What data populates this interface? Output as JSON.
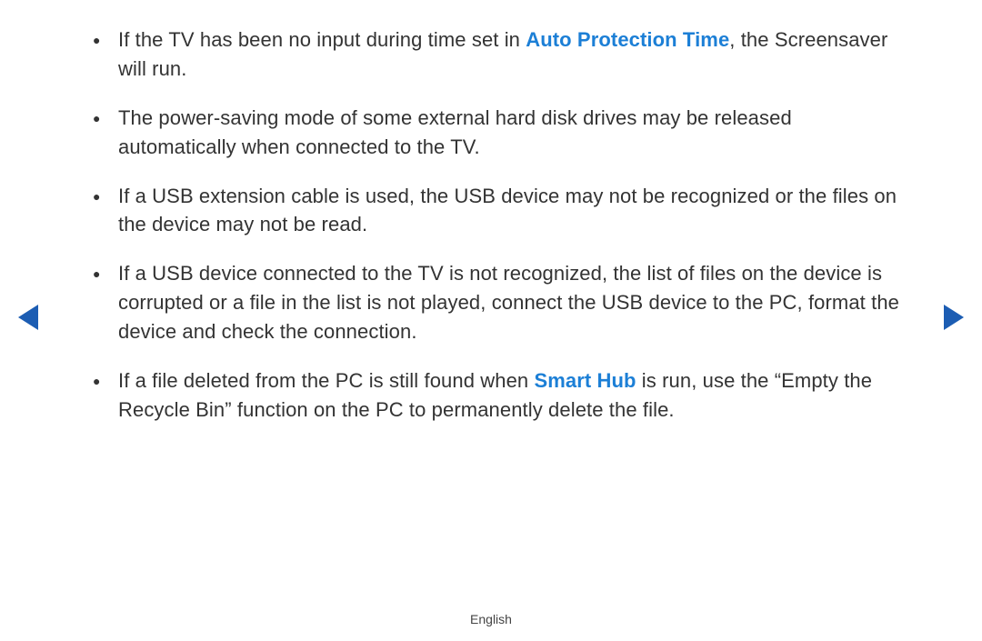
{
  "bullets": [
    {
      "pre": "If the TV has been no input during time set in ",
      "highlight": "Auto Protection Time",
      "post": ", the Screensaver will run."
    },
    {
      "pre": "The power-saving mode of some external hard disk drives may be released automatically when connected to the TV.",
      "highlight": "",
      "post": ""
    },
    {
      "pre": "If a USB extension cable is used, the USB device may not be recognized or the files on the device may not be read.",
      "highlight": "",
      "post": ""
    },
    {
      "pre": "If a USB device connected to the TV is not recognized, the list of files on the device is corrupted or a file in the list is not played, connect the USB device to the PC, format the device and check the connection.",
      "highlight": "",
      "post": ""
    },
    {
      "pre": "If a file deleted from the PC is still found when ",
      "highlight": "Smart Hub",
      "post": " is run, use the “Empty the Recycle Bin” function on the PC to permanently delete the file."
    }
  ],
  "footer": {
    "language": "English"
  }
}
